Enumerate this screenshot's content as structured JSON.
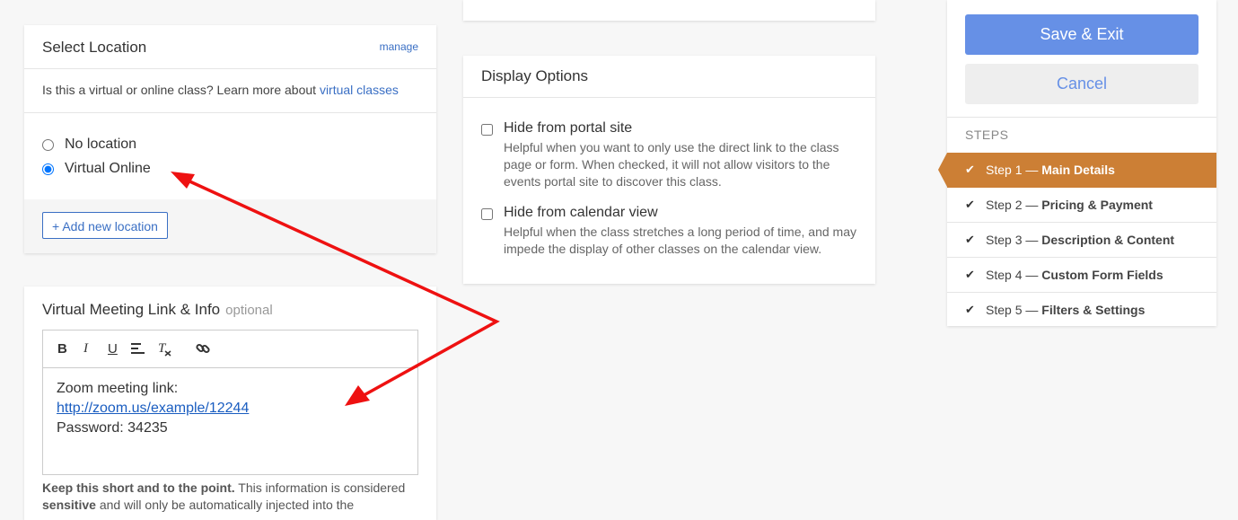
{
  "location": {
    "title": "Select Location",
    "manage_label": "manage",
    "virtual_prompt": "Is this a virtual or online class? Learn more about",
    "virtual_link": "virtual classes",
    "options": [
      {
        "label": "No location",
        "checked": false
      },
      {
        "label": "Virtual Online",
        "checked": true
      }
    ],
    "add_label": "+ Add new location"
  },
  "virtual_meeting": {
    "title": "Virtual Meeting Link & Info",
    "optional": "optional",
    "toolbar": [
      "B",
      "I",
      "U",
      "align-icon",
      "clear-format-icon",
      "link-icon"
    ],
    "line1": "Zoom meeting link:",
    "link": "http://zoom.us/example/12244",
    "line3": "Password: 34235",
    "note_bold1": "Keep this short and to the point.",
    "note_text1": " This information is considered ",
    "note_bold2": "sensitive",
    "note_text2": " and will only be automatically injected into the"
  },
  "display": {
    "title": "Display Options",
    "options": [
      {
        "label": "Hide from portal site",
        "desc": "Helpful when you want to only use the direct link to the class page or form. When checked, it will not allow visitors to the events portal site to discover this class."
      },
      {
        "label": "Hide from calendar view",
        "desc": "Helpful when the class stretches a long period of time, and may impede the display of other classes on the calendar view."
      }
    ]
  },
  "sidebar": {
    "save_label": "Save & Exit",
    "cancel_label": "Cancel",
    "steps_heading": "STEPS",
    "steps": [
      {
        "prefix": "Step 1 — ",
        "name": "Main Details",
        "active": true
      },
      {
        "prefix": "Step 2 — ",
        "name": "Pricing & Payment",
        "active": false
      },
      {
        "prefix": "Step 3 — ",
        "name": "Description & Content",
        "active": false
      },
      {
        "prefix": "Step 4 — ",
        "name": "Custom Form Fields",
        "active": false
      },
      {
        "prefix": "Step 5 — ",
        "name": "Filters & Settings",
        "active": false
      }
    ]
  },
  "colors": {
    "accent": "#6690e6",
    "active_step": "#cc7f35",
    "link": "#3a6fc4",
    "arrow": "#ee1111"
  }
}
